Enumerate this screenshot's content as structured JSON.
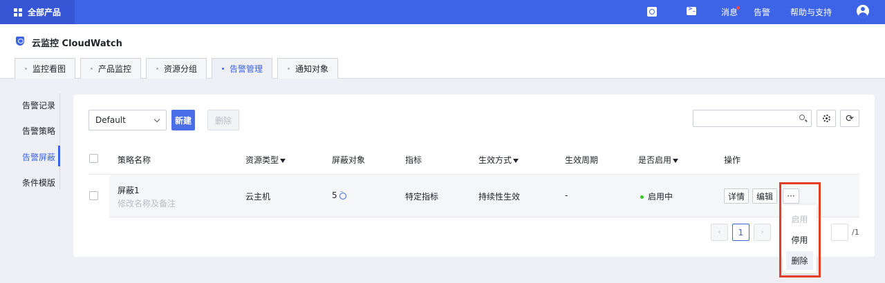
{
  "topbar": {
    "products_label": "全部产品",
    "links": {
      "messages": "消息",
      "alarm": "告警",
      "help": "帮助与支持"
    },
    "icons": [
      "grid-icon",
      "search-icon",
      "terminal-icon",
      "avatar-icon"
    ]
  },
  "app": {
    "title": "云监控 CloudWatch"
  },
  "tabs": [
    {
      "label": "监控看图",
      "active": false
    },
    {
      "label": "产品监控",
      "active": false
    },
    {
      "label": "资源分组",
      "active": false
    },
    {
      "label": "告警管理",
      "active": true
    },
    {
      "label": "通知对象",
      "active": false
    }
  ],
  "sidebar": {
    "items": [
      {
        "label": "告警记录",
        "active": false
      },
      {
        "label": "告警策略",
        "active": false
      },
      {
        "label": "告警屏蔽",
        "active": true
      },
      {
        "label": "条件模版",
        "active": false
      }
    ]
  },
  "toolbar": {
    "select_value": "Default",
    "new_label": "新建",
    "delete_label": "删除"
  },
  "table": {
    "headers": {
      "name": "策略名称",
      "resource_type": "资源类型",
      "target": "屏蔽对象",
      "metric": "指标",
      "effect_mode": "生效方式",
      "period": "生效周期",
      "enabled": "是否启用",
      "actions": "操作"
    },
    "rows": [
      {
        "name": "屏蔽1",
        "name_hint": "修改名称及备注",
        "resource_type": "云主机",
        "target_count": "5",
        "metric": "特定指标",
        "effect_mode": "持续性生效",
        "period": "-",
        "enabled": "启用中",
        "actions": {
          "detail": "详情",
          "edit": "编辑",
          "more": "···"
        }
      }
    ]
  },
  "pagination": {
    "prev": "‹",
    "current": "1",
    "next": "›",
    "total": "/1"
  },
  "dropdown": {
    "items": [
      {
        "label": "启用",
        "disabled": true
      },
      {
        "label": "停用",
        "disabled": false
      },
      {
        "label": "删除",
        "disabled": false,
        "hover": true
      }
    ]
  },
  "colors": {
    "primary": "#3d64e6",
    "highlight": "#e53d2a",
    "status_on": "#34c724"
  }
}
